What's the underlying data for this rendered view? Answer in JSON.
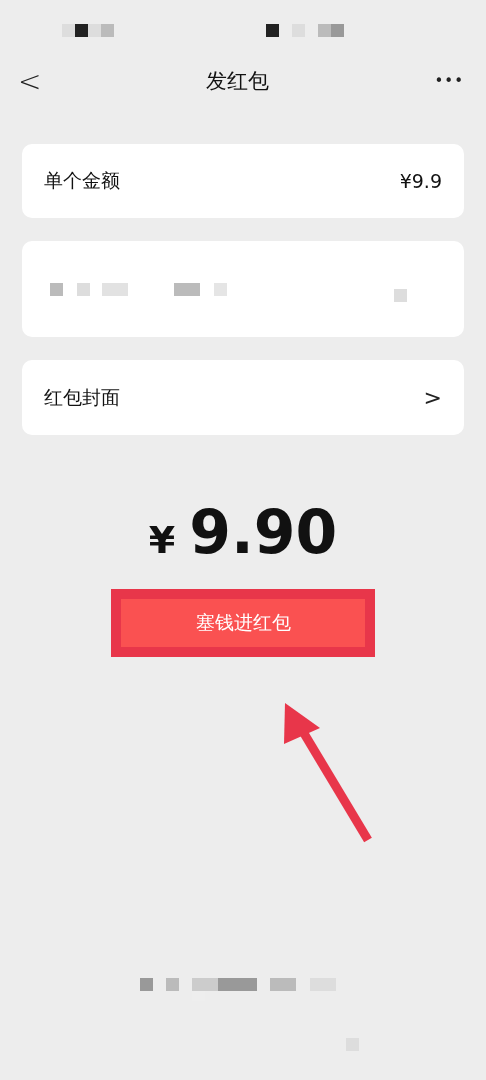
{
  "nav": {
    "back": "<",
    "title": "发红包",
    "more": "•••"
  },
  "amount_row": {
    "label": "单个金额",
    "value": "¥9.9"
  },
  "cover_row": {
    "label": "红包封面",
    "chevron": ">"
  },
  "total": {
    "currency": "¥",
    "amount": "9.90"
  },
  "submit": {
    "label": "塞钱进红包",
    "highlighted": true
  }
}
